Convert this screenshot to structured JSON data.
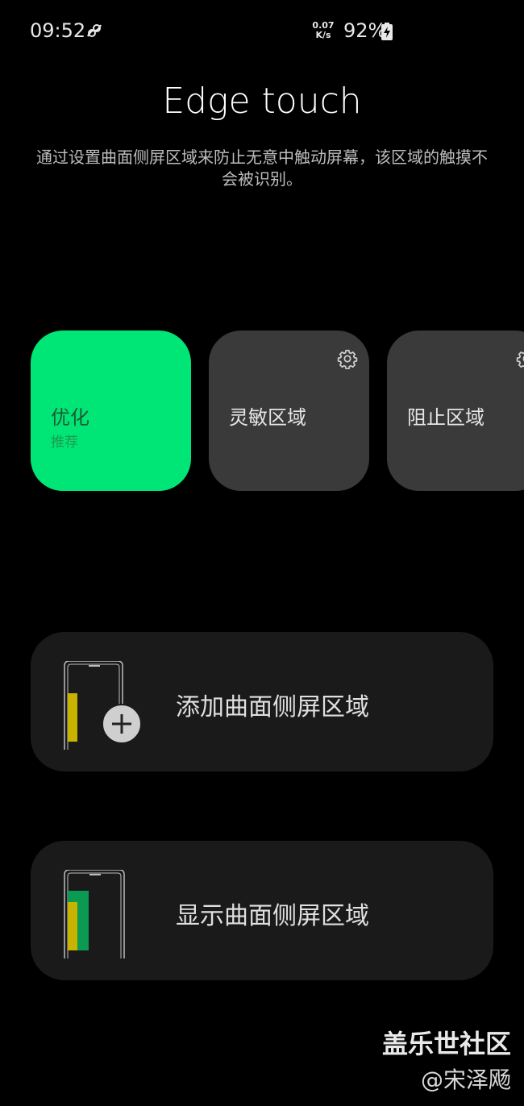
{
  "status": {
    "time": "09:52",
    "speed_value": "0.07",
    "speed_unit": "K/s",
    "battery": "92%"
  },
  "header": {
    "title": "Edge touch",
    "description": "通过设置曲面侧屏区域来防止无意中触动屏幕，该区域的触摸不会被识别。"
  },
  "modes": [
    {
      "label": "优化",
      "sub": "推荐"
    },
    {
      "label": "灵敏区域"
    },
    {
      "label": "阻止区域"
    }
  ],
  "actions": {
    "add": "添加曲面侧屏区域",
    "show": "显示曲面侧屏区域"
  },
  "watermark": {
    "line1": "盖乐世社区",
    "line2": "@宋泽飏"
  },
  "colors": {
    "accent": "#00e676",
    "card": "#3a3a3a",
    "action_card": "#1a1a1a",
    "edge_yellow": "#c8b400",
    "edge_green": "#0a9a52"
  },
  "icons": [
    "link-icon",
    "battery-charging-icon",
    "gear-icon",
    "plus-icon"
  ]
}
